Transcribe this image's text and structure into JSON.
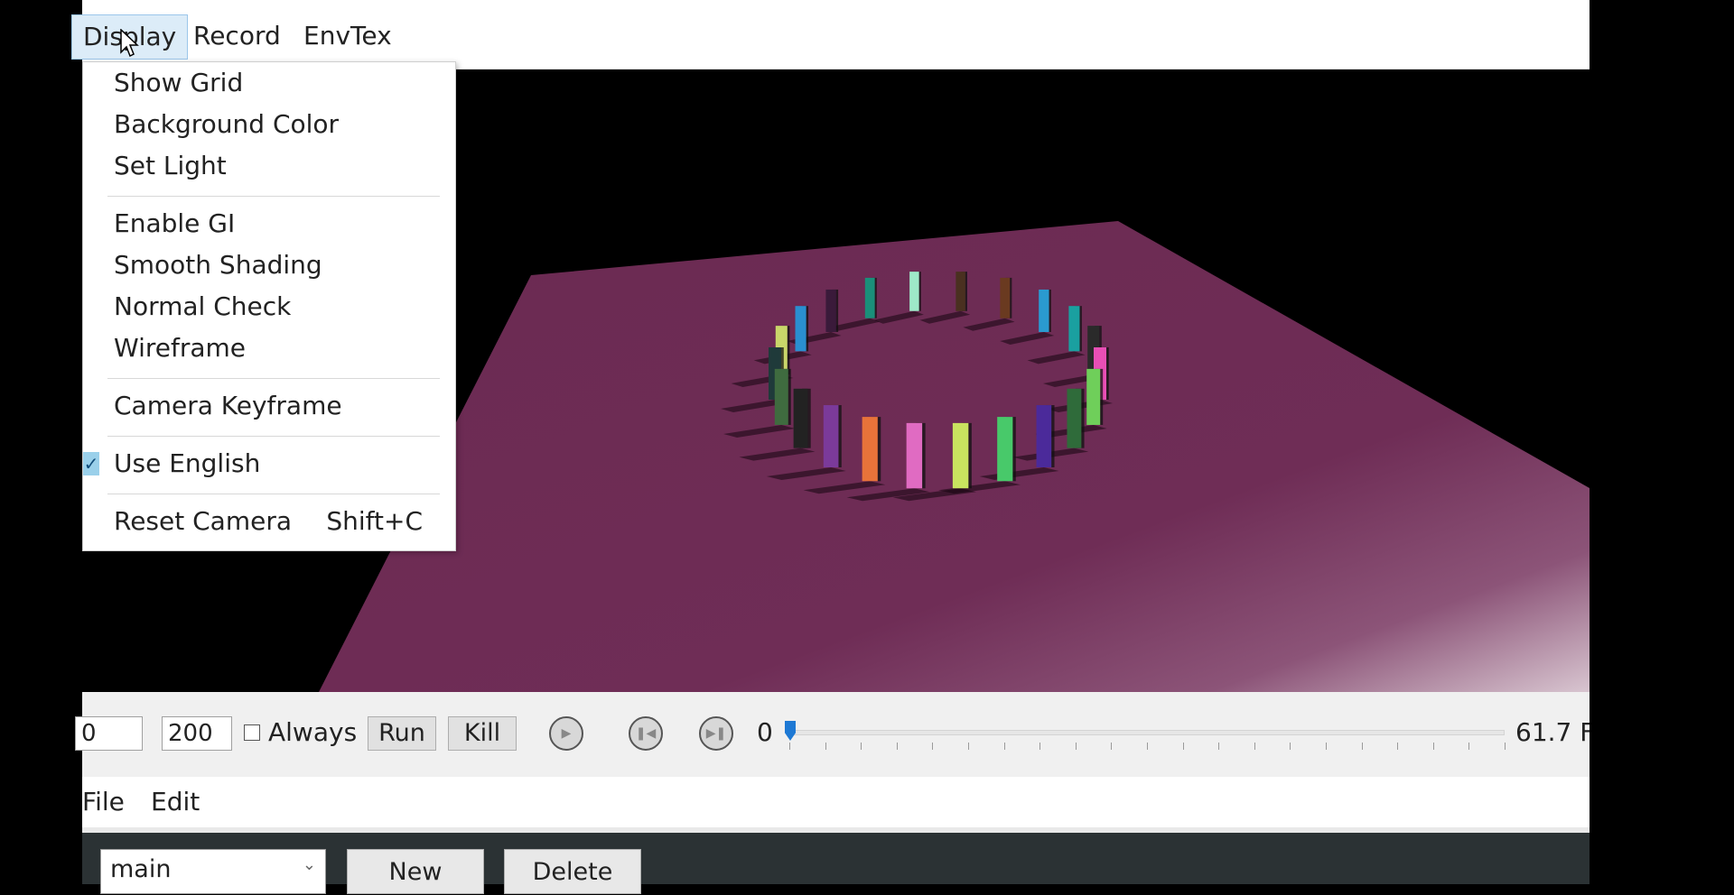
{
  "top_menu": {
    "items": [
      {
        "label": "Display",
        "active": true
      },
      {
        "label": "Record",
        "active": false
      },
      {
        "label": "EnvTex",
        "active": false
      }
    ]
  },
  "display_menu": {
    "items": [
      {
        "label": "Show Grid",
        "checked": false,
        "shortcut": ""
      },
      {
        "label": "Background Color",
        "checked": false,
        "shortcut": ""
      },
      {
        "label": "Set Light",
        "checked": false,
        "shortcut": ""
      },
      {
        "label": "Enable GI",
        "checked": false,
        "shortcut": ""
      },
      {
        "label": "Smooth Shading",
        "checked": false,
        "shortcut": ""
      },
      {
        "label": "Normal Check",
        "checked": false,
        "shortcut": ""
      },
      {
        "label": "Wireframe",
        "checked": false,
        "shortcut": ""
      },
      {
        "label": "Camera Keyframe",
        "checked": false,
        "shortcut": ""
      },
      {
        "label": "Use English",
        "checked": true,
        "shortcut": ""
      },
      {
        "label": "Reset Camera",
        "checked": false,
        "shortcut": "Shift+C"
      }
    ],
    "check_glyph": "✓"
  },
  "controls": {
    "start_value": "0",
    "end_value": "200",
    "always_label": "Always",
    "always_checked": false,
    "run_label": "Run",
    "kill_label": "Kill",
    "frame_value": "0",
    "slider_position": 0,
    "fps_text": "61.7 FP",
    "play_icon": "play-icon",
    "prev_icon": "step-back-icon",
    "next_icon": "step-forward-icon"
  },
  "lower_menu": {
    "items": [
      {
        "label": "File"
      },
      {
        "label": "Edit"
      }
    ]
  },
  "bottom_panel": {
    "select_value": "main",
    "new_label": "New",
    "delete_label": "Delete"
  },
  "colors": {
    "floor": "#6b2a52",
    "accent": "#1e79d4",
    "menu_highlight": "#dcecf8"
  }
}
